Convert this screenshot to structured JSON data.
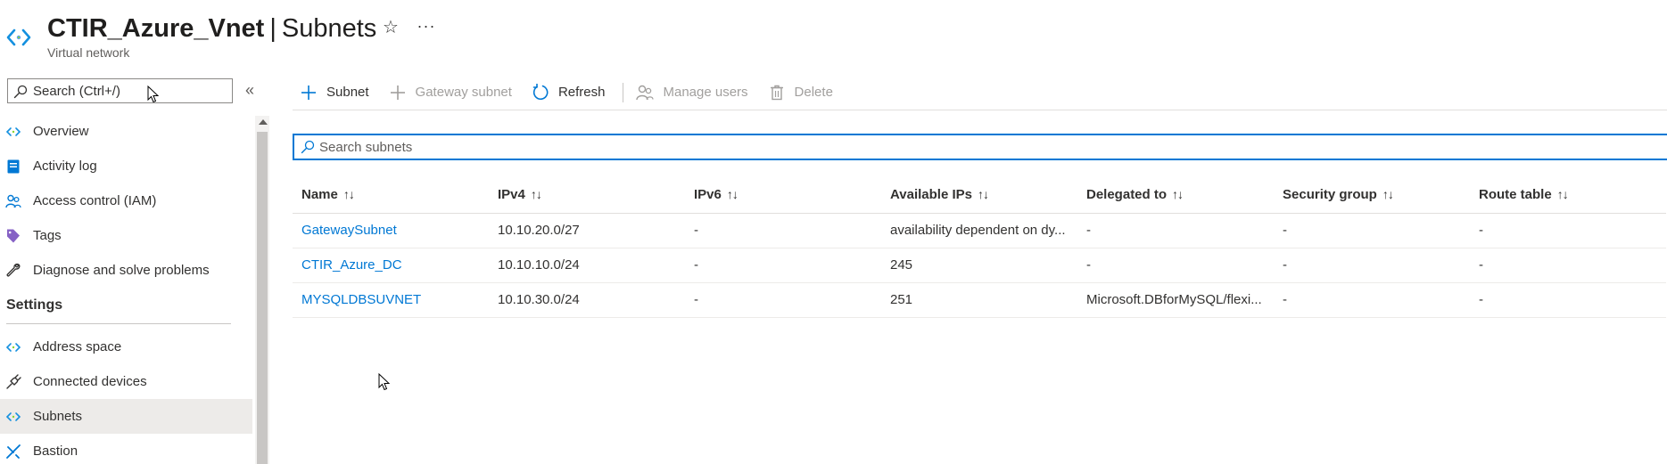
{
  "header": {
    "resource_name": "CTIR_Azure_Vnet",
    "separator": "|",
    "page_title": "Subnets",
    "subtitle": "Virtual network",
    "favorite_glyph": "☆",
    "more_glyph": "···"
  },
  "sidebar": {
    "search": {
      "placeholder": "Search (Ctrl+/)"
    },
    "collapse_glyph": "«",
    "items": [
      {
        "label": "Overview",
        "icon": "vnet-icon"
      },
      {
        "label": "Activity log",
        "icon": "activity-log-icon"
      },
      {
        "label": "Access control (IAM)",
        "icon": "people-icon"
      },
      {
        "label": "Tags",
        "icon": "tag-icon"
      },
      {
        "label": "Diagnose and solve problems",
        "icon": "wrench-icon"
      }
    ],
    "section_title": "Settings",
    "settings_items": [
      {
        "label": "Address space",
        "icon": "vnet-icon"
      },
      {
        "label": "Connected devices",
        "icon": "plug-icon"
      },
      {
        "label": "Subnets",
        "icon": "vnet-icon",
        "active": true
      },
      {
        "label": "Bastion",
        "icon": "bastion-icon"
      }
    ]
  },
  "toolbar": {
    "subnet": "Subnet",
    "gateway_subnet": "Gateway subnet",
    "refresh": "Refresh",
    "manage_users": "Manage users",
    "delete": "Delete"
  },
  "search_subnets": {
    "placeholder": "Search subnets"
  },
  "table": {
    "sort_glyph": "↑↓",
    "columns": [
      "Name",
      "IPv4",
      "IPv6",
      "Available IPs",
      "Delegated to",
      "Security group",
      "Route table"
    ],
    "rows": [
      [
        "GatewaySubnet",
        "10.10.20.0/27",
        "-",
        "availability dependent on dy...",
        "-",
        "-",
        "-"
      ],
      [
        "CTIR_Azure_DC",
        "10.10.10.0/24",
        "-",
        "245",
        "-",
        "-",
        "-"
      ],
      [
        "MYSQLDBSUVNET",
        "10.10.30.0/24",
        "-",
        "251",
        "Microsoft.DBforMySQL/flexi...",
        "-",
        "-"
      ]
    ]
  },
  "colors": {
    "accent": "#0078d4",
    "vnet_icon": "#1490df",
    "tag_icon": "#8661c5",
    "active_nav_bg": "#edebe9"
  }
}
